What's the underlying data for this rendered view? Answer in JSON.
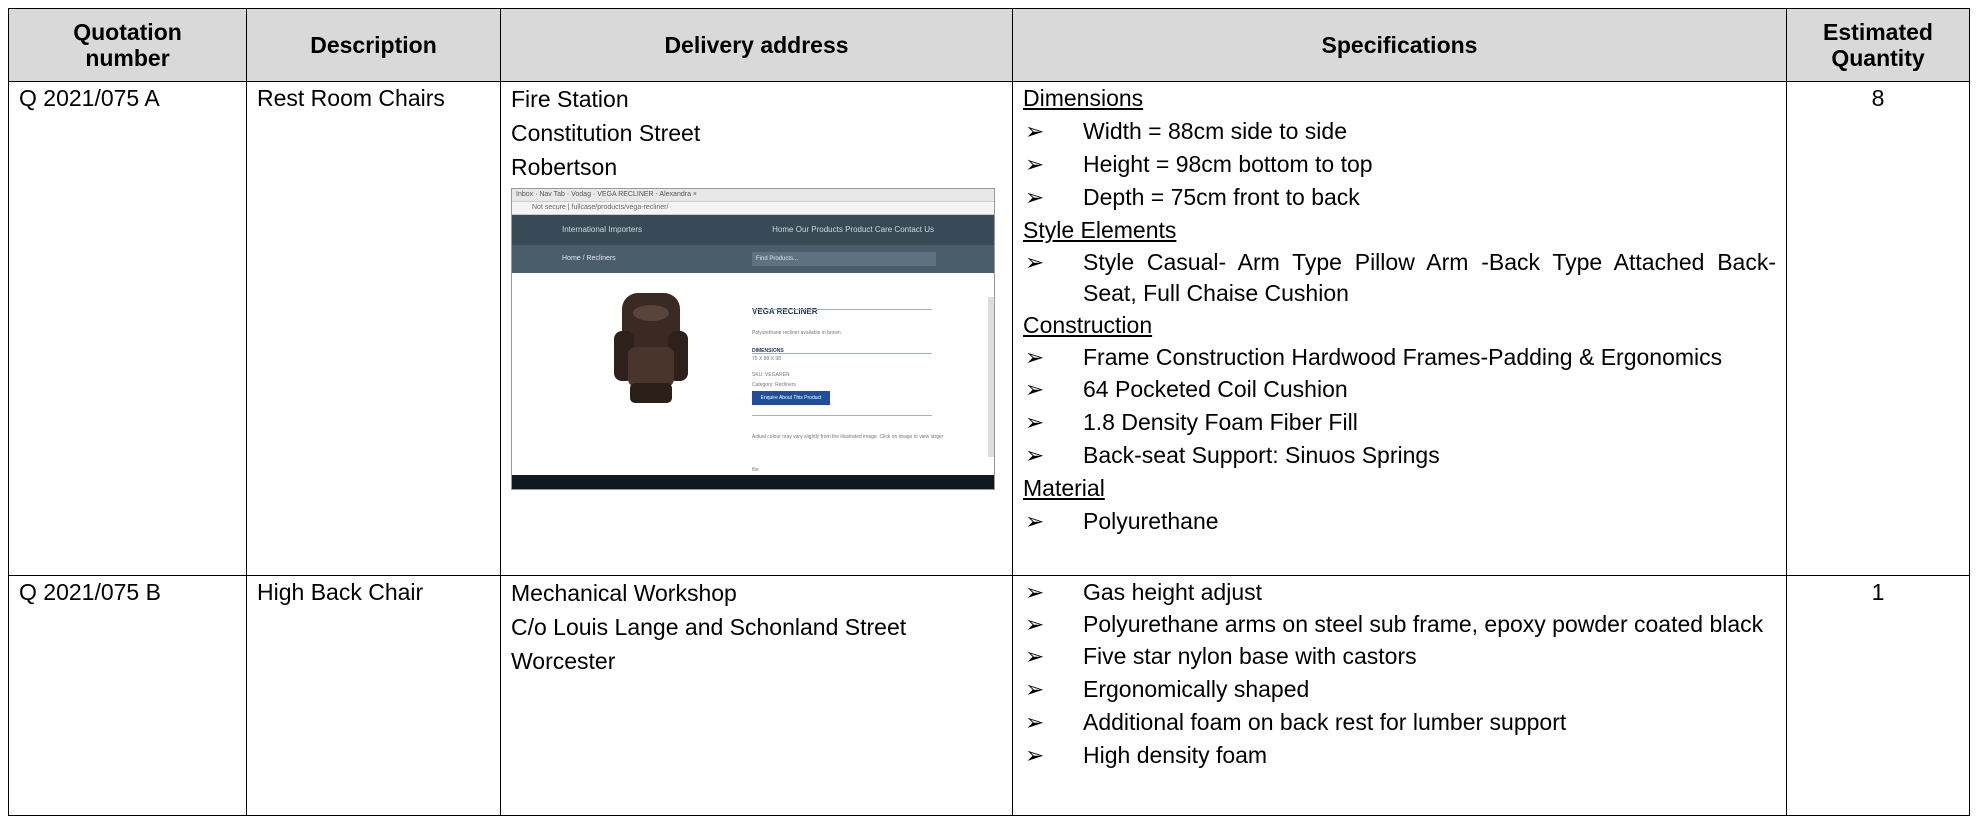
{
  "table": {
    "headers": {
      "quotation": [
        "Quotation",
        "number"
      ],
      "description": "Description",
      "delivery": "Delivery address",
      "specifications": "Specifications",
      "quantity": [
        "Estimated",
        "Quantity"
      ]
    },
    "bullet_glyph": "➢",
    "rows": [
      {
        "quotation": "Q 2021/075 A",
        "description": "Rest Room Chairs",
        "address": [
          "Fire Station",
          "Constitution Street",
          "Robertson"
        ],
        "screenshot": {
          "tabs": "Inbox · Nav Tab · Vodag · VEGA RECLINER - Alexandra ×",
          "url": "Not secure | fullcase/products/vega-recliner/",
          "site_tagline": "International Importers",
          "site_nav": "Home   Our Products   Product Care   Contact Us",
          "breadcrumb": "Home / Recliners",
          "find": "Find Products...",
          "product_title": "VEGA RECLINER",
          "product_desc": "Polyurethane recliner available in brown",
          "dimensions_label": "DIMENSIONS",
          "dimensions_value": "75 X 88 X 98",
          "sku": "SKU: VEGAREN",
          "category": "Category: Recliners",
          "enquire": "Enquire About This Product",
          "note": "Actual colour may vary slightly from the illustrated image. Click on image to view larger file."
        },
        "spec_sections": [
          {
            "heading": "Dimensions",
            "items": [
              "Width = 88cm side to side",
              "Height = 98cm bottom to top",
              "Depth = 75cm front to back"
            ]
          },
          {
            "heading": "Style Elements",
            "items": [
              "Style Casual- Arm Type Pillow Arm -Back Type Attached Back- Seat, Full Chaise Cushion"
            ]
          },
          {
            "heading": "Construction",
            "items": [
              "Frame Construction Hardwood Frames-Padding & Ergonomics",
              "64 Pocketed Coil Cushion",
              "1.8 Density Foam Fiber Fill",
              "Back-seat Support: Sinuos Springs"
            ]
          },
          {
            "heading": "Material",
            "items": [
              "Polyurethane"
            ]
          }
        ],
        "quantity": "8"
      },
      {
        "quotation": "Q 2021/075 B",
        "description": "High Back Chair",
        "address": [
          "Mechanical Workshop",
          "C/o Louis Lange and Schonland Street",
          "Worcester"
        ],
        "spec_items": [
          "Gas height adjust",
          "Polyurethane arms on steel sub frame, epoxy powder coated black",
          "Five star nylon base with castors",
          "Ergonomically shaped",
          "Additional foam on back rest for lumber support",
          "High density foam"
        ],
        "quantity": "1"
      }
    ]
  }
}
